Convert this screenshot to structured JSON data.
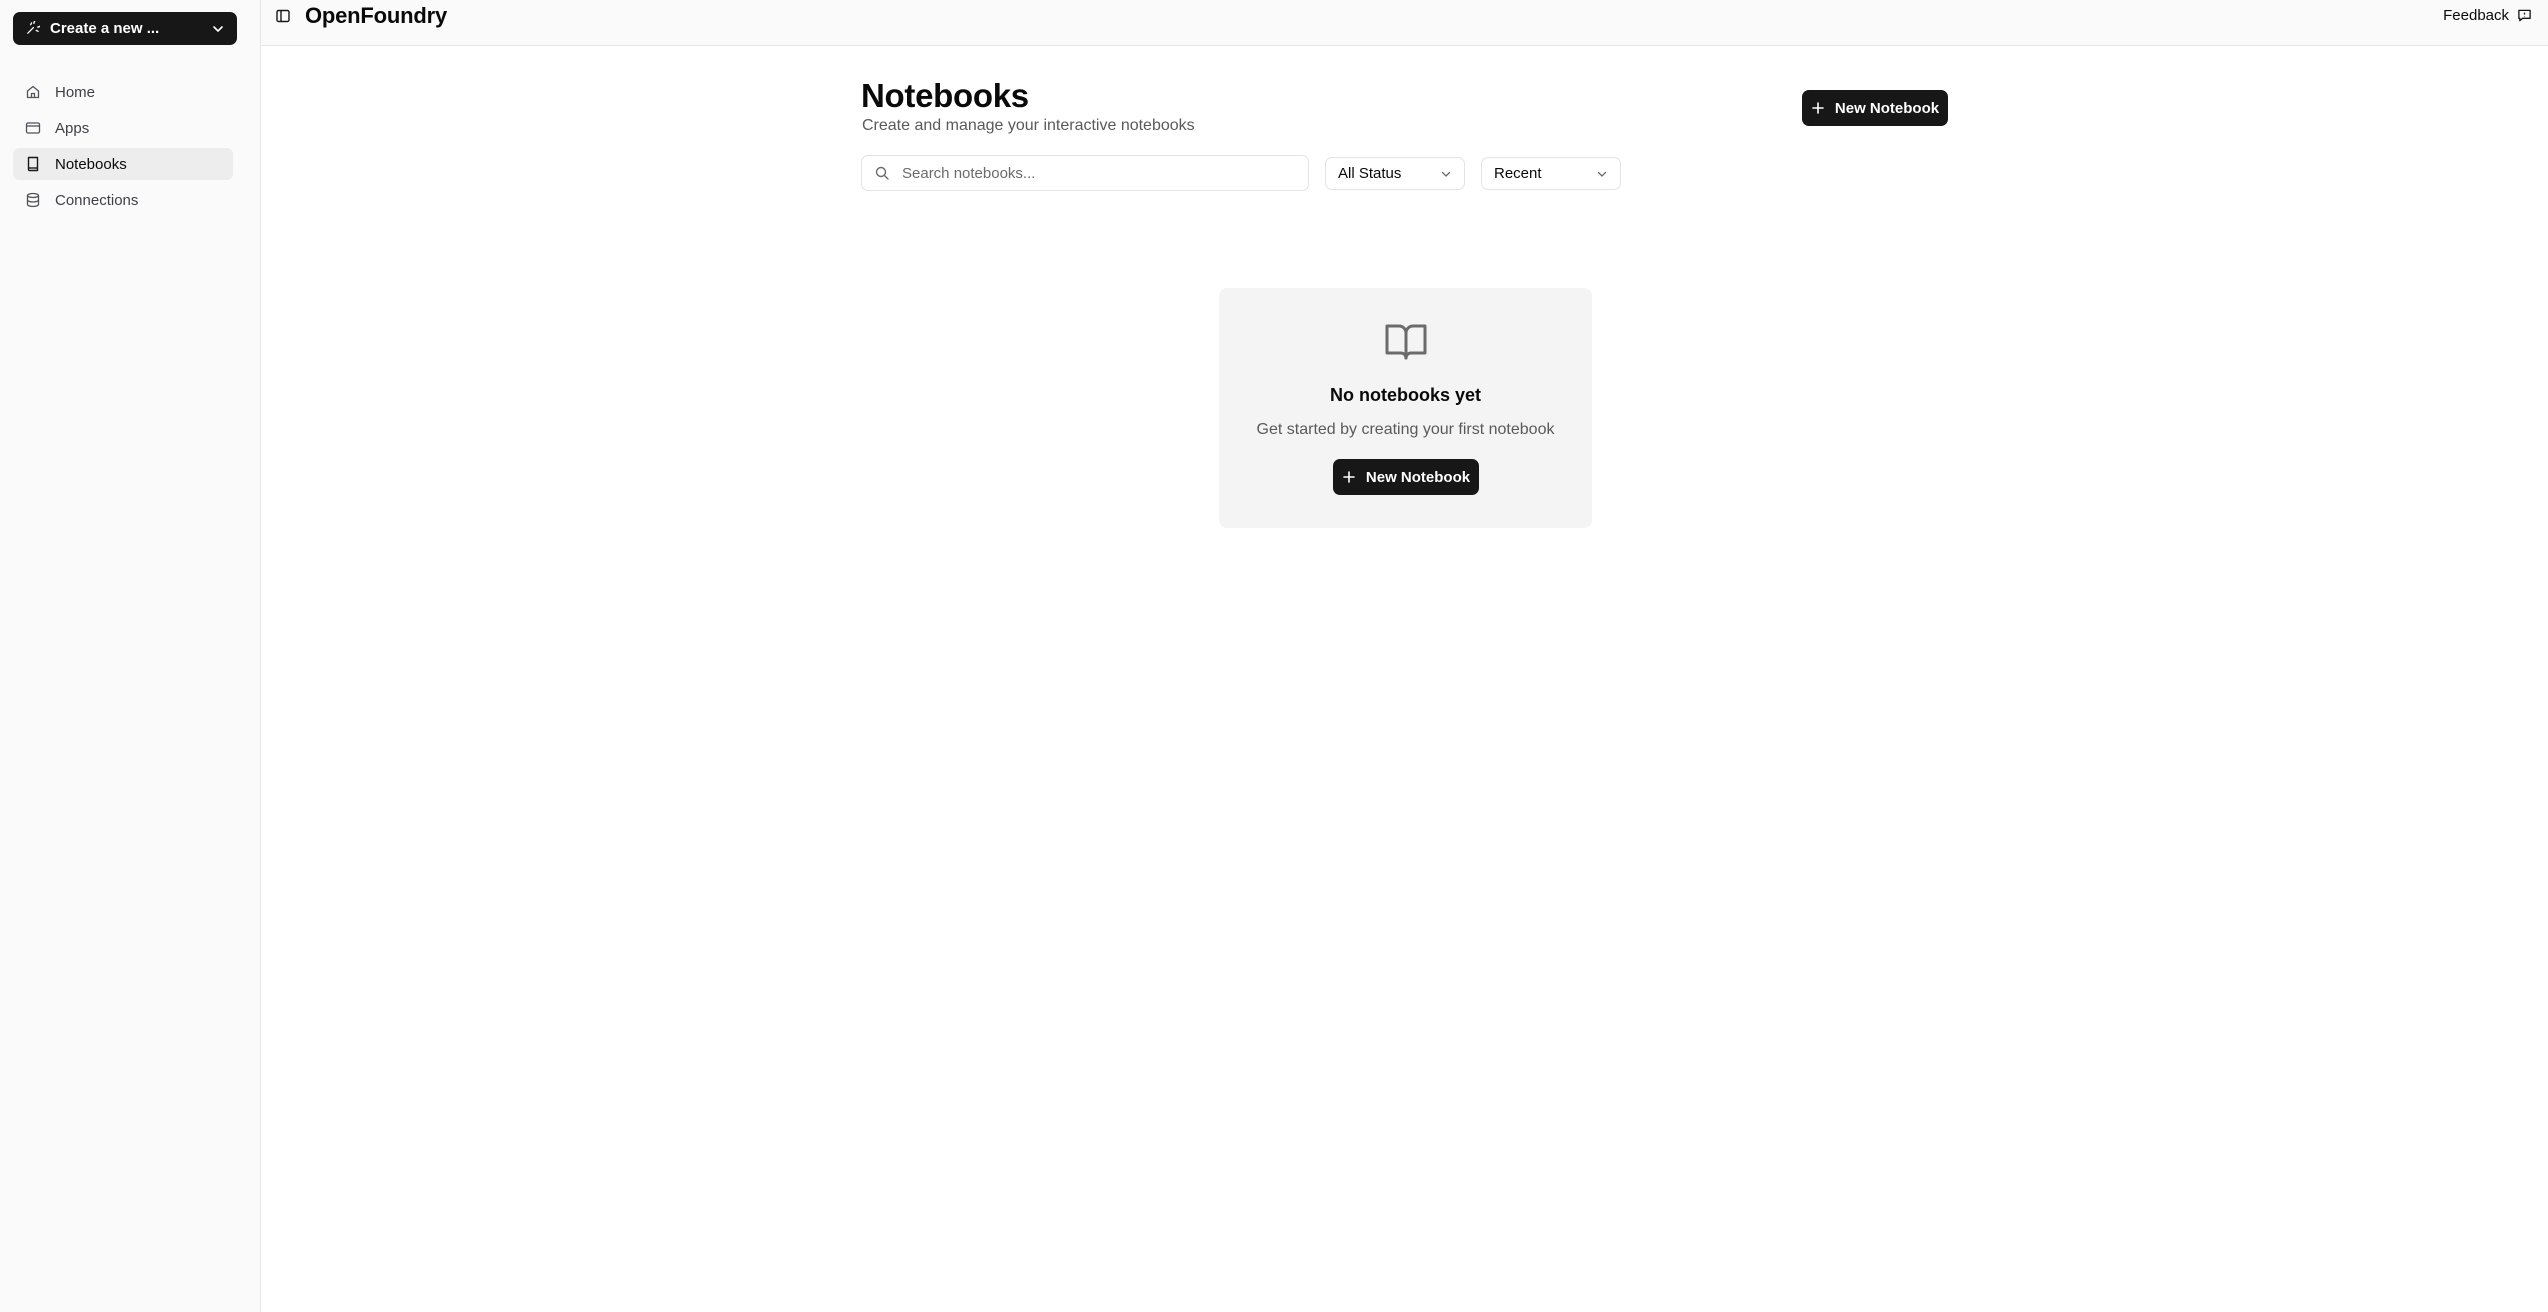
{
  "sidebar": {
    "create_label": "Create a new ...",
    "items": [
      {
        "label": "Home",
        "icon": "home-icon"
      },
      {
        "label": "Apps",
        "icon": "apps-icon"
      },
      {
        "label": "Notebooks",
        "icon": "notebook-icon",
        "active": true
      },
      {
        "label": "Connections",
        "icon": "database-icon"
      }
    ]
  },
  "topbar": {
    "brand": "OpenFoundry",
    "feedback_label": "Feedback"
  },
  "main": {
    "title": "Notebooks",
    "subtitle": "Create and manage your interactive notebooks",
    "new_button_label": "New Notebook",
    "search_placeholder": "Search notebooks...",
    "status_filter": "All Status",
    "sort_filter": "Recent",
    "empty_state": {
      "title": "No notebooks yet",
      "subtitle": "Get started by creating your first notebook",
      "button_label": "New Notebook"
    }
  },
  "colors": {
    "primary_button": "#171717",
    "sidebar_bg": "#fafafa",
    "empty_card_bg": "#f4f4f4"
  }
}
